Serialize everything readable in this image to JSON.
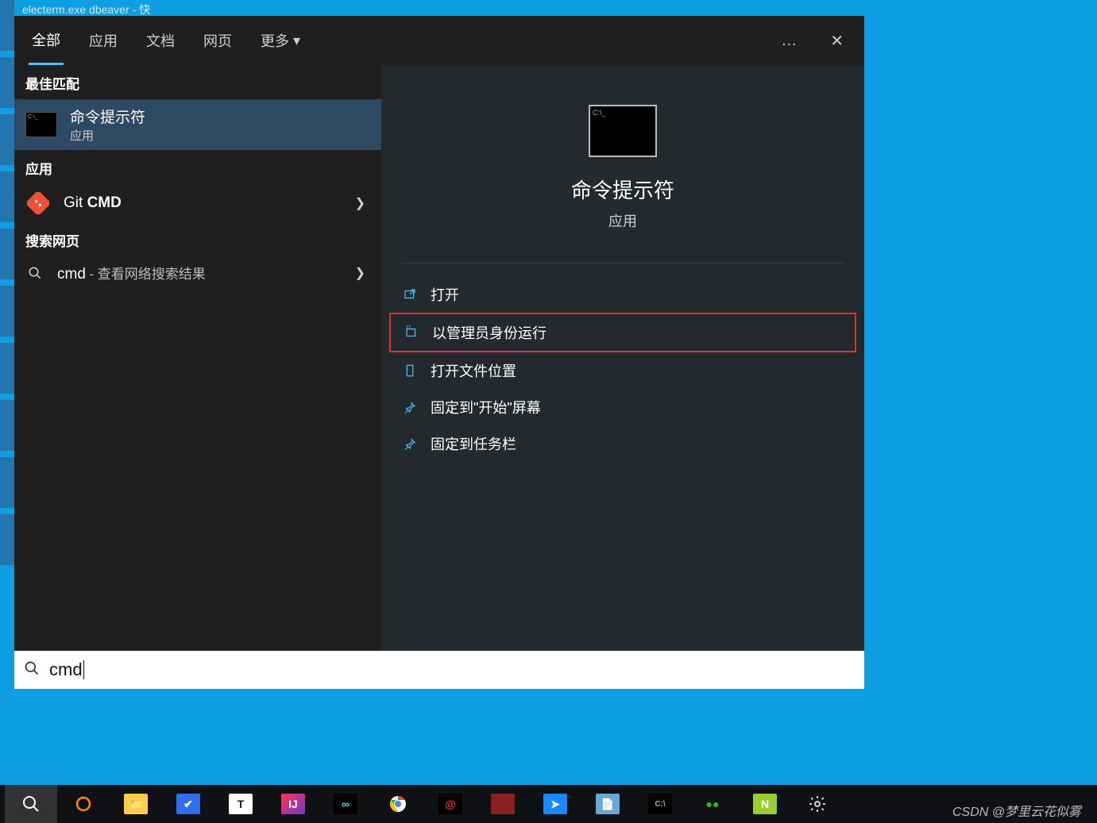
{
  "titlebar": {
    "caption": "electerm.exe dbeaver - 快"
  },
  "tabs": {
    "all": "全部",
    "apps": "应用",
    "documents": "文档",
    "web": "网页",
    "more": "更多",
    "dots": "…",
    "close": "✕"
  },
  "left": {
    "best_match": "最佳匹配",
    "cmd_title": "命令提示符",
    "cmd_sub": "应用",
    "apps_head": "应用",
    "git_cmd_prefix": "Git ",
    "git_cmd_bold": "CMD",
    "search_web_head": "搜索网页",
    "web_query": "cmd",
    "web_suffix": " - 查看网络搜索结果"
  },
  "preview": {
    "title": "命令提示符",
    "sub": "应用",
    "actions": {
      "open": "打开",
      "run_as_admin": "以管理员身份运行",
      "open_location": "打开文件位置",
      "pin_start": "固定到\"开始\"屏幕",
      "pin_taskbar": "固定到任务栏"
    }
  },
  "search": {
    "query": "cmd"
  },
  "taskbar": {
    "icons": [
      "search",
      "cortana",
      "explorer",
      "todo",
      "text",
      "intellij",
      "cloud",
      "chrome",
      "swirl",
      "redbox",
      "bluearrow",
      "notepad",
      "terminal",
      "wechat",
      "notepadpp",
      "settings"
    ]
  },
  "watermark": "CSDN @梦里云花似雾"
}
